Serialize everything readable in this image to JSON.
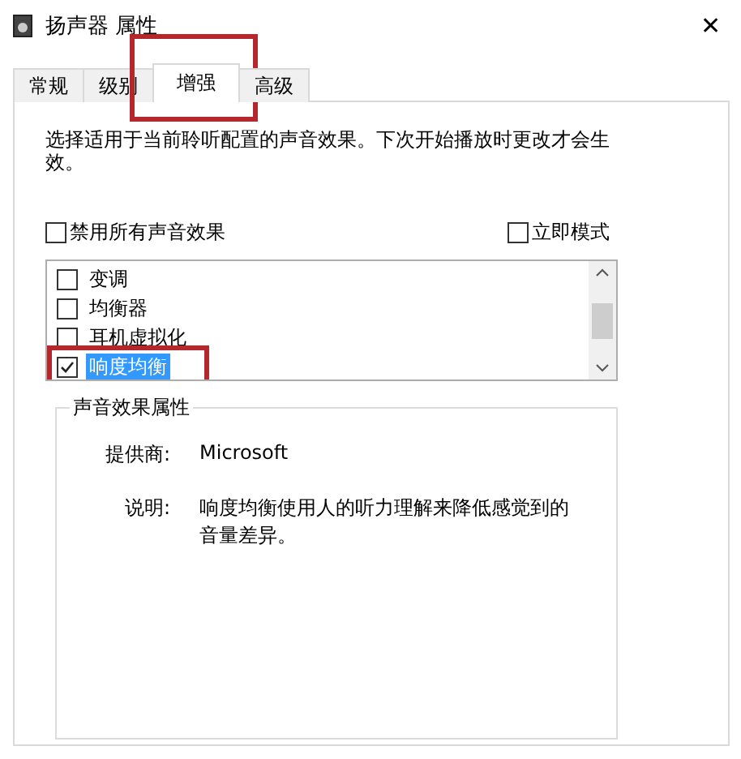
{
  "window": {
    "title": "扬声器 属性",
    "close": "✕"
  },
  "tabs": [
    {
      "label": "常规",
      "selected": false,
      "highlighted": false
    },
    {
      "label": "级别",
      "selected": false,
      "highlighted": false
    },
    {
      "label": "增强",
      "selected": true,
      "highlighted": true
    },
    {
      "label": "高级",
      "selected": false,
      "highlighted": false
    }
  ],
  "intro": "选择适用于当前聆听配置的声音效果。下次开始播放时更改才会生效。",
  "options": [
    {
      "label": "禁用所有声音效果",
      "checked": false
    },
    {
      "label": "立即模式",
      "checked": false
    }
  ],
  "effects": [
    {
      "label": "变调",
      "checked": false,
      "selected": false,
      "highlighted": false
    },
    {
      "label": "均衡器",
      "checked": false,
      "selected": false,
      "highlighted": false
    },
    {
      "label": "耳机虚拟化",
      "checked": false,
      "selected": false,
      "highlighted": false
    },
    {
      "label": "响度均衡",
      "checked": true,
      "selected": true,
      "highlighted": true
    }
  ],
  "properties": {
    "title": "声音效果属性",
    "fields": [
      {
        "label": "提供商:",
        "value": "Microsoft"
      },
      {
        "label": "说明:",
        "value": "响度均衡使用人的听力理解来降低感觉到的音量差异。"
      }
    ]
  }
}
